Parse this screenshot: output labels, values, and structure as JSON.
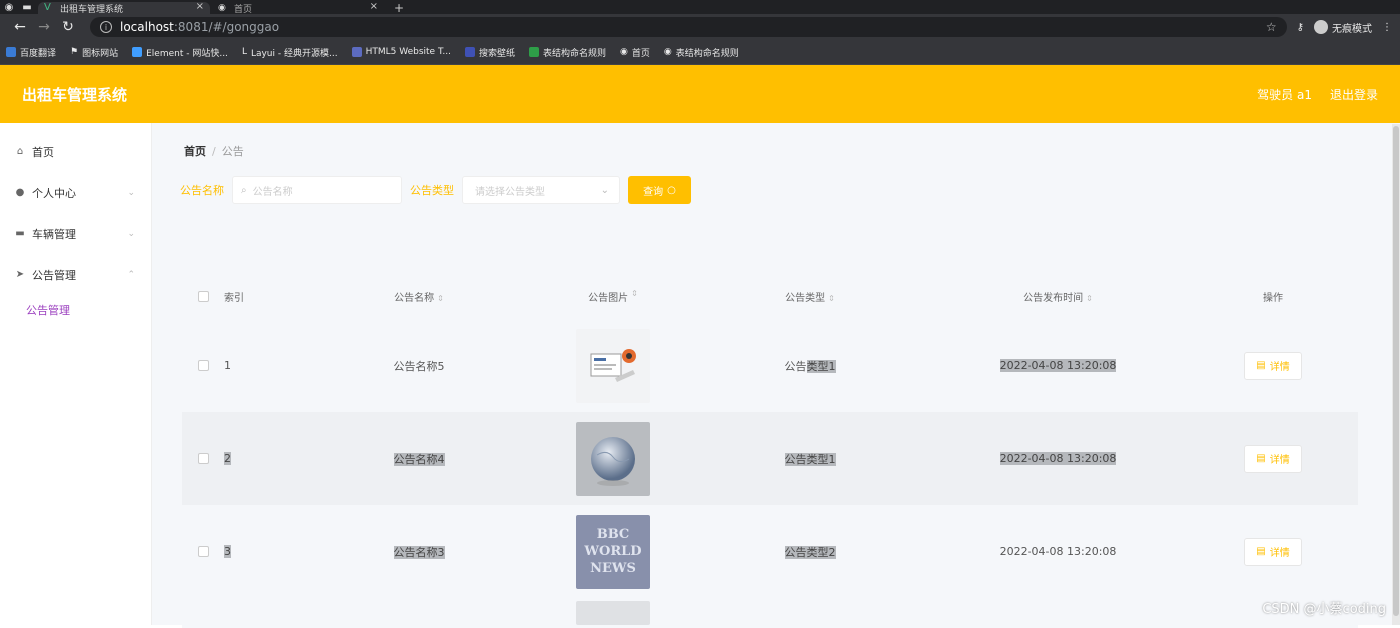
{
  "browser": {
    "tabs": [
      {
        "title": "出租车管理系统",
        "active": true
      },
      {
        "title": "首页",
        "active": false
      }
    ],
    "url_host": "localhost",
    "url_path": ":8081/#/gonggao",
    "profile_label": "无痕模式",
    "bookmarks": [
      {
        "label": "百度翻译"
      },
      {
        "label": "图标网站"
      },
      {
        "label": "Element - 网站快..."
      },
      {
        "label": "Layui - 经典开源模..."
      },
      {
        "label": "HTML5 Website T..."
      },
      {
        "label": "搜索壁纸"
      },
      {
        "label": "表结构命名规则"
      },
      {
        "label": "首页"
      },
      {
        "label": "表结构命名规则"
      }
    ]
  },
  "header": {
    "title": "出租车管理系统",
    "user": "驾驶员 a1",
    "logout": "退出登录",
    "accent": "#ffbf00"
  },
  "sidebar": {
    "items": [
      {
        "label": "首页",
        "icon": "home-icon"
      },
      {
        "label": "个人中心",
        "icon": "user-icon"
      },
      {
        "label": "车辆管理",
        "icon": "car-icon"
      },
      {
        "label": "公告管理",
        "icon": "paper-plane-icon"
      }
    ],
    "submenu": {
      "label": "公告管理"
    }
  },
  "breadcrumb": {
    "home": "首页",
    "current": "公告"
  },
  "search": {
    "name_label": "公告名称",
    "name_placeholder": "公告名称",
    "type_label": "公告类型",
    "type_placeholder": "请选择公告类型",
    "query_label": "查询"
  },
  "table": {
    "headers": {
      "index": "索引",
      "name": "公告名称",
      "picture": "公告图片",
      "type": "公告类型",
      "time": "公告发布时间",
      "op": "操作"
    },
    "rows": [
      {
        "index": "1",
        "name": "公告名称5",
        "type_a": "公告",
        "type_b": "类型1",
        "time": "2022-04-08 13:20:08",
        "op": "详情"
      },
      {
        "index": "2",
        "name": "公告名称4",
        "type_a": "公告类型1",
        "type_b": "",
        "time": "2022-04-08 13:20:08",
        "op": "详情"
      },
      {
        "index": "3",
        "name": "公告名称3",
        "type_a": "公告类型2",
        "type_b": "",
        "time": "2022-04-08 13:20:08",
        "op": "详情"
      }
    ],
    "thumb_world_lines": [
      "BBC",
      "WORLD",
      "NEWS"
    ]
  },
  "watermark": "CSDN @小蔡coding"
}
